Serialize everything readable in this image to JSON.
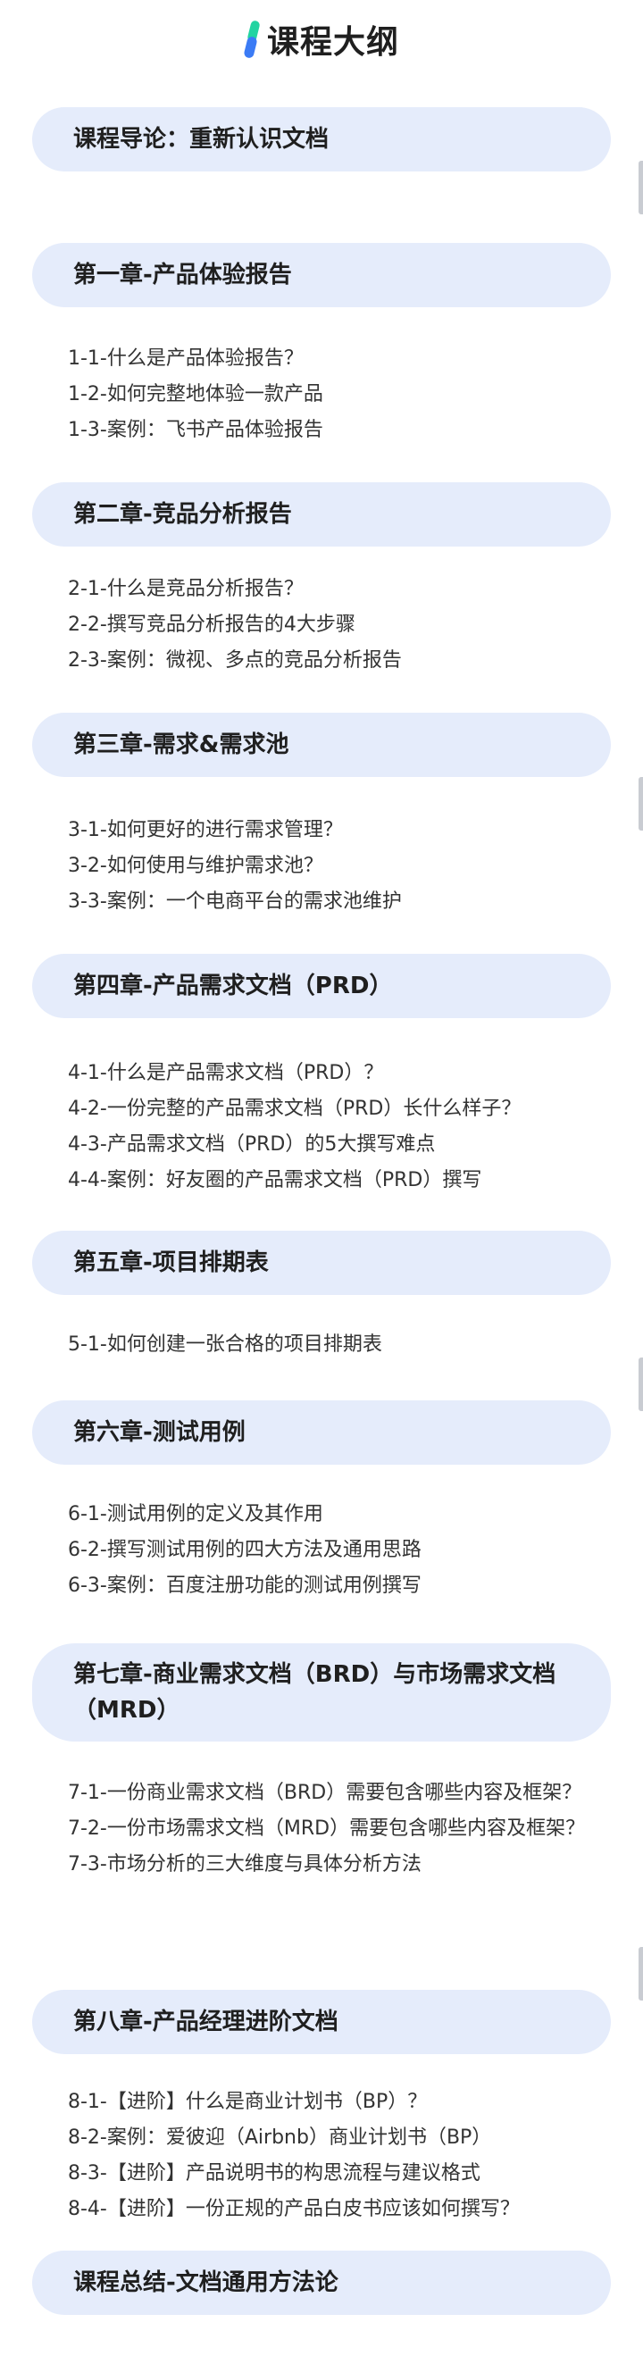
{
  "header": {
    "title": "课程大纲"
  },
  "sections": [
    {
      "title": "课程导论：重新认识文档",
      "items": []
    },
    {
      "title": "第一章-产品体验报告",
      "items": [
        "1-1-什么是产品体验报告？",
        "1-2-如何完整地体验一款产品",
        "1-3-案例：飞书产品体验报告"
      ]
    },
    {
      "title": "第二章-竞品分析报告",
      "items": [
        "2-1-什么是竞品分析报告？",
        "2-2-撰写竞品分析报告的4大步骤",
        "2-3-案例：微视、多点的竞品分析报告"
      ]
    },
    {
      "title": "第三章-需求&需求池",
      "items": [
        "3-1-如何更好的进行需求管理？",
        "3-2-如何使用与维护需求池？",
        "3-3-案例：一个电商平台的需求池维护"
      ]
    },
    {
      "title": "第四章-产品需求文档（PRD）",
      "items": [
        "4-1-什么是产品需求文档（PRD）？",
        "4-2-一份完整的产品需求文档（PRD）长什么样子？",
        "4-3-产品需求文档（PRD）的5大撰写难点",
        "4-4-案例：好友圈的产品需求文档（PRD）撰写"
      ]
    },
    {
      "title": "第五章-项目排期表",
      "items": [
        "5-1-如何创建一张合格的项目排期表"
      ]
    },
    {
      "title": "第六章-测试用例",
      "items": [
        "6-1-测试用例的定义及其作用",
        "6-2-撰写测试用例的四大方法及通用思路",
        "6-3-案例：百度注册功能的测试用例撰写"
      ]
    },
    {
      "title": "第七章-商业需求文档（BRD）与市场需求文档（MRD）",
      "items": [
        "7-1-一份商业需求文档（BRD）需要包含哪些内容及框架？",
        "7-2-一份市场需求文档（MRD）需要包含哪些内容及框架？",
        "7-3-市场分析的三大维度与具体分析方法"
      ]
    },
    {
      "title": "第八章-产品经理进阶文档",
      "items": [
        "8-1-【进阶】什么是商业计划书（BP）？",
        "8-2-案例：爱彼迎（Airbnb）商业计划书（BP）",
        "8-3-【进阶】产品说明书的构思流程与建议格式",
        "8-4-【进阶】一份正规的产品白皮书应该如何撰写？"
      ]
    },
    {
      "title": "课程总结-文档通用方法论",
      "items": []
    }
  ]
}
